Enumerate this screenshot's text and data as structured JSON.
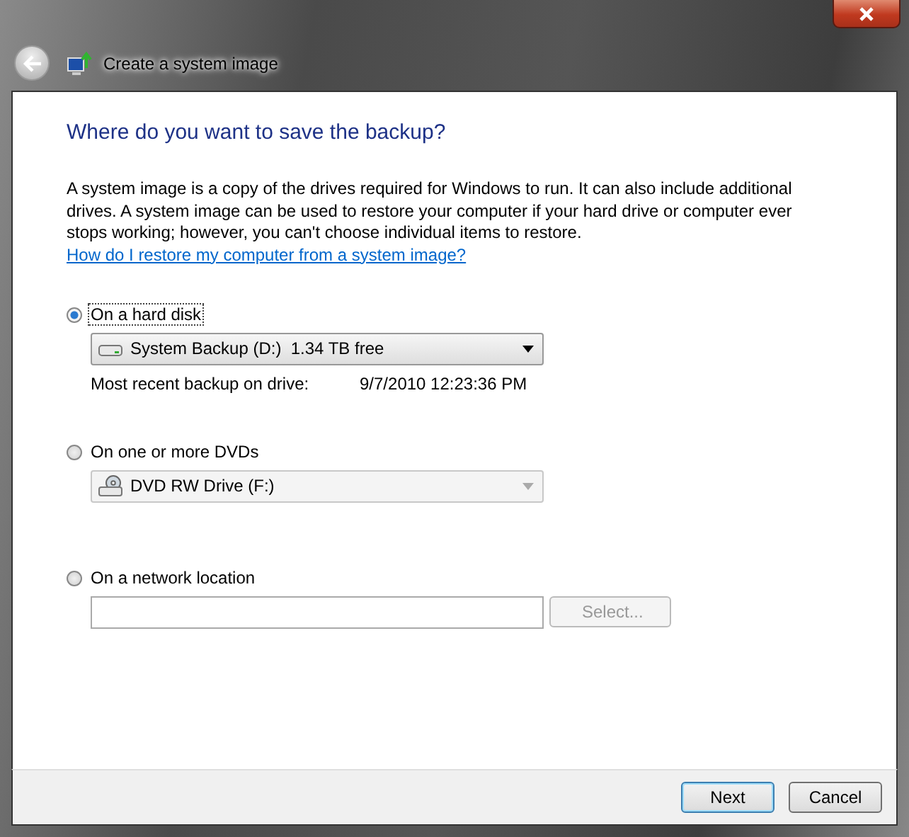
{
  "window": {
    "title": "Create a system image"
  },
  "heading": "Where do you want to save the backup?",
  "description": {
    "text": "A system image is a copy of the drives required for Windows to run. It can also include additional drives. A system image can be used to restore your computer if your hard drive or computer ever stops working; however, you can't choose individual items to restore.",
    "link": "How do I restore my computer from a system image?"
  },
  "options": [
    {
      "kind": "hard-disk",
      "label": "On a hard disk",
      "selected": true,
      "dropdown": {
        "value": "System Backup (D:)  1.34 TB free",
        "disabled": false
      },
      "info": {
        "label": "Most recent backup on drive:",
        "value": "9/7/2010 12:23:36 PM"
      }
    },
    {
      "kind": "dvd",
      "label": "On one or more DVDs",
      "selected": false,
      "dropdown": {
        "value": "DVD RW Drive (F:)",
        "disabled": true
      }
    },
    {
      "kind": "network",
      "label": "On a network location",
      "selected": false,
      "button": {
        "label": "Select...",
        "disabled": true
      }
    }
  ],
  "buttons": [
    {
      "label": "Next",
      "default": true
    },
    {
      "label": "Cancel",
      "default": false
    }
  ]
}
